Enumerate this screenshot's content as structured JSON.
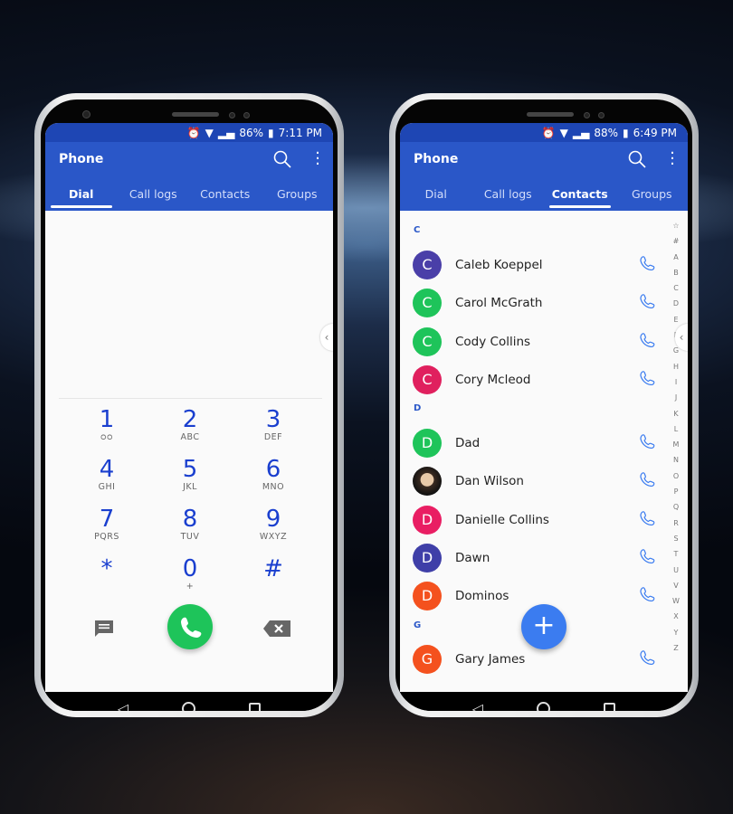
{
  "colors": {
    "primary": "#2a57c8",
    "status_bar": "#1e46b4",
    "call_green": "#1ec45a",
    "fab": "#3b7cf0",
    "digit": "#1a3fcf"
  },
  "left_phone": {
    "status": {
      "battery": "86%",
      "time": "7:11 PM"
    },
    "app_title": "Phone",
    "tabs": [
      "Dial",
      "Call logs",
      "Contacts",
      "Groups"
    ],
    "active_tab": "Dial",
    "keys": [
      {
        "d": "1",
        "l": "voicemail-icon"
      },
      {
        "d": "2",
        "l": "ABC"
      },
      {
        "d": "3",
        "l": "DEF"
      },
      {
        "d": "4",
        "l": "GHI"
      },
      {
        "d": "5",
        "l": "JKL"
      },
      {
        "d": "6",
        "l": "MNO"
      },
      {
        "d": "7",
        "l": "PQRS"
      },
      {
        "d": "8",
        "l": "TUV"
      },
      {
        "d": "9",
        "l": "WXYZ"
      },
      {
        "d": "*",
        "l": ""
      },
      {
        "d": "0",
        "l": "+"
      },
      {
        "d": "#",
        "l": ""
      }
    ]
  },
  "right_phone": {
    "status": {
      "battery": "88%",
      "time": "6:49 PM"
    },
    "app_title": "Phone",
    "tabs": [
      "Dial",
      "Call logs",
      "Contacts",
      "Groups"
    ],
    "active_tab": "Contacts",
    "sections": [
      {
        "letter": "C",
        "contacts": [
          {
            "initial": "C",
            "name": "Caleb Koeppel",
            "color": "#4a3fa8"
          },
          {
            "initial": "C",
            "name": "Carol McGrath",
            "color": "#1ec45a"
          },
          {
            "initial": "C",
            "name": "Cody Collins",
            "color": "#1ec45a"
          },
          {
            "initial": "C",
            "name": "Cory Mcleod",
            "color": "#e0205e"
          }
        ]
      },
      {
        "letter": "D",
        "contacts": [
          {
            "initial": "D",
            "name": "Dad",
            "color": "#1ec45a"
          },
          {
            "initial": "",
            "name": "Dan Wilson",
            "color": "photo"
          },
          {
            "initial": "D",
            "name": "Danielle Collins",
            "color": "#e91e63"
          },
          {
            "initial": "D",
            "name": "Dawn",
            "color": "#3f3fa8"
          },
          {
            "initial": "D",
            "name": "Dominos",
            "color": "#f4511e"
          }
        ]
      },
      {
        "letter": "G",
        "contacts": [
          {
            "initial": "G",
            "name": "Gary James",
            "color": "#f4511e"
          }
        ]
      }
    ],
    "index": [
      "☆",
      "#",
      "A",
      "B",
      "C",
      "D",
      "E",
      "F",
      "G",
      "H",
      "I",
      "J",
      "K",
      "L",
      "M",
      "N",
      "O",
      "P",
      "Q",
      "R",
      "S",
      "T",
      "U",
      "V",
      "W",
      "X",
      "Y",
      "Z"
    ],
    "fab": "+"
  }
}
